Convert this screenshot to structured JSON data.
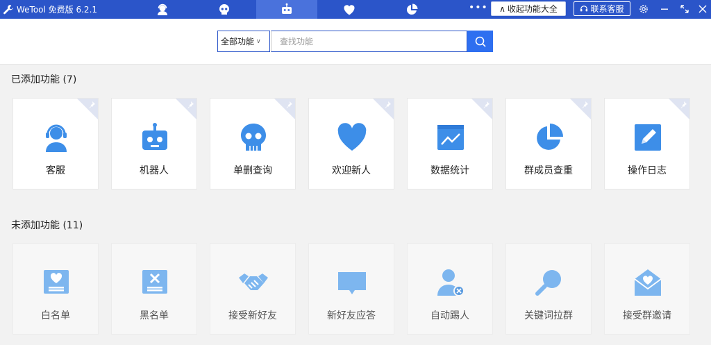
{
  "app": {
    "title": "WeTool 免费版 6.2.1"
  },
  "nav": {
    "tabs": [
      {
        "icon": "customer-service-icon"
      },
      {
        "icon": "skull-icon"
      },
      {
        "icon": "robot-icon",
        "active": true
      },
      {
        "icon": "heart-icon"
      },
      {
        "icon": "pie-chart-icon"
      }
    ]
  },
  "toolbar": {
    "collapse_label": "收起功能大全",
    "collapse_prefix": "∧",
    "support_label": "联系客服"
  },
  "search": {
    "scope_value": "全部功能",
    "placeholder": "查找功能",
    "value": ""
  },
  "added": {
    "title": "已添加功能 (7)",
    "items": [
      {
        "label": "客服",
        "icon": "customer-service-icon"
      },
      {
        "label": "机器人",
        "icon": "robot-icon"
      },
      {
        "label": "单删查询",
        "icon": "skull-icon"
      },
      {
        "label": "欢迎新人",
        "icon": "heart-icon"
      },
      {
        "label": "数据统计",
        "icon": "line-chart-icon"
      },
      {
        "label": "群成员查重",
        "icon": "pie-chart-icon"
      },
      {
        "label": "操作日志",
        "icon": "edit-icon"
      }
    ]
  },
  "unadded": {
    "title": "未添加功能 (11)",
    "items": [
      {
        "label": "白名单",
        "icon": "whitelist-icon"
      },
      {
        "label": "黑名单",
        "icon": "blacklist-icon"
      },
      {
        "label": "接受新好友",
        "icon": "handshake-icon"
      },
      {
        "label": "新好友应答",
        "icon": "chat-bubble-icon"
      },
      {
        "label": "自动踢人",
        "icon": "remove-user-icon"
      },
      {
        "label": "关键词拉群",
        "icon": "magnifier-icon"
      },
      {
        "label": "接受群邀请",
        "icon": "envelope-heart-icon"
      }
    ]
  },
  "colors": {
    "titlebar": "#2b55c9",
    "accent": "#2e6ff0",
    "icon_blue": "#3d8ee8",
    "icon_light": "#8fc2f1"
  }
}
